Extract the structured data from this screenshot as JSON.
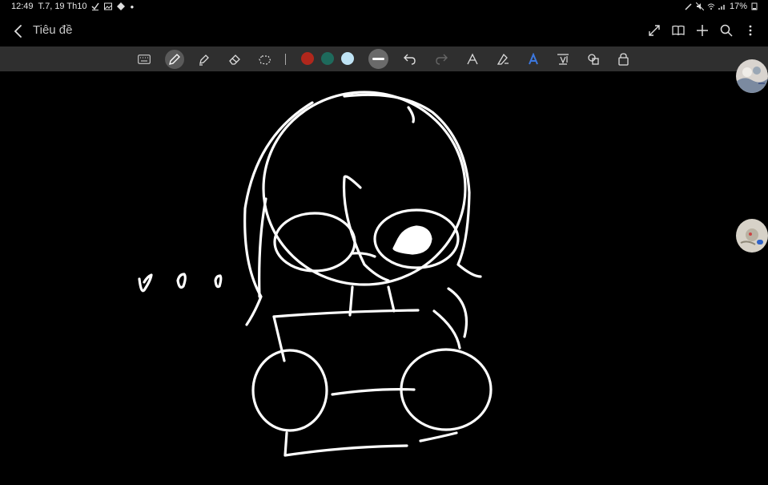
{
  "status": {
    "time": "12:49",
    "date": "T.7, 19 Th10",
    "battery": "17%"
  },
  "appbar": {
    "title": "Tiêu đề"
  },
  "toolbar": {
    "colors": [
      "#b0271c",
      "#1e6a5c",
      "#bfe3f4"
    ]
  },
  "icons": {
    "back": "chevron-left-icon",
    "expand": "expand-icon",
    "book": "book-icon",
    "add": "plus-icon",
    "search": "search-icon",
    "more": "more-vert-icon"
  }
}
